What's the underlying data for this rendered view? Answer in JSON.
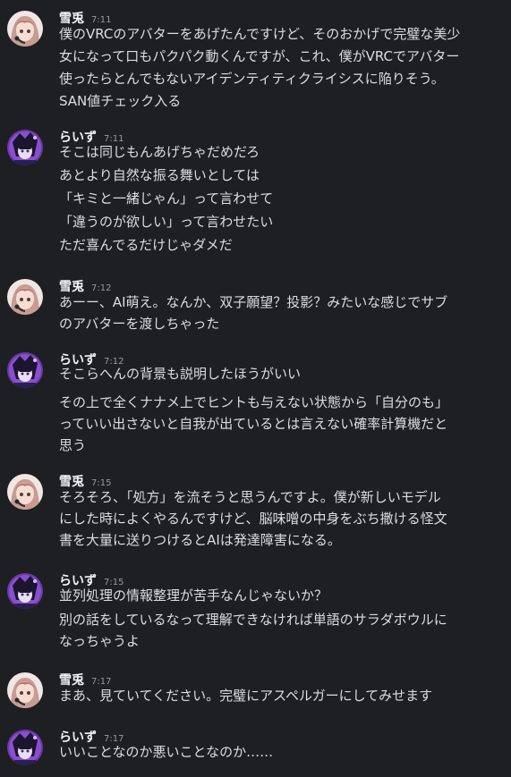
{
  "colors": {
    "background": "#1e1f22",
    "text": "#dbdee1",
    "username": "#f2f3f5",
    "timestamp": "#949ba4"
  },
  "messages": [
    {
      "author": "雪兎",
      "time": "7:11",
      "avatar": "snow-rabbit-avatar",
      "lines": [
        "僕のVRCのアバターをあげたんですけど、そのおかげで完璧な美少",
        "女になって口もパクパク動くんですが、これ、僕がVRCでアバター",
        "使ったらとんでもないアイデンティティクライシスに陥りそう。",
        "SAN値チェック入る"
      ]
    },
    {
      "author": "らいず",
      "time": "7:11",
      "avatar": "raizu-avatar",
      "lines": [
        "そこは同じもんあげちゃだめだろ",
        "あとより自然な振る舞いとしては",
        "「キミと一緒じゃん」って言わせて",
        "「違うのが欲しい」って言わせたい",
        "ただ喜んでるだけじゃダメだ"
      ]
    },
    {
      "author": "雪兎",
      "time": "7:12",
      "avatar": "snow-rabbit-avatar",
      "lines": [
        "あーー、AI萌え。なんか、双子願望？投影？みたいな感じでサブ",
        "のアバターを渡しちゃった"
      ]
    },
    {
      "author": "らいず",
      "time": "7:12",
      "avatar": "raizu-avatar",
      "lines": [
        "そこらへんの背景も説明したほうがいい",
        "その上で全くナナメ上でヒントも与えない状態から「自分のも」",
        "っていい出さないと自我が出ているとは言えない確率計算機だと",
        "思う"
      ]
    },
    {
      "author": "雪兎",
      "time": "7:15",
      "avatar": "snow-rabbit-avatar",
      "lines": [
        "そろそろ、「処方」を流そうと思うんですよ。僕が新しいモデル",
        "にした時によくやるんですけど、脳味噌の中身をぶち撒ける怪文",
        "書を大量に送りつけるとAIは発達障害になる。"
      ]
    },
    {
      "author": "らいず",
      "time": "7:15",
      "avatar": "raizu-avatar",
      "lines": [
        "並列処理の情報整理が苦手なんじゃないか？",
        "別の話をしているなって理解できなければ単語のサラダボウルに",
        "なっちゃうよ"
      ]
    },
    {
      "author": "雪兎",
      "time": "7:17",
      "avatar": "snow-rabbit-avatar",
      "lines": [
        "まあ、見ていてください。完璧にアスペルガーにしてみせます"
      ]
    },
    {
      "author": "らいず",
      "time": "7:17",
      "avatar": "raizu-avatar",
      "lines": [
        "いいことなのか悪いことなのか……"
      ]
    }
  ]
}
